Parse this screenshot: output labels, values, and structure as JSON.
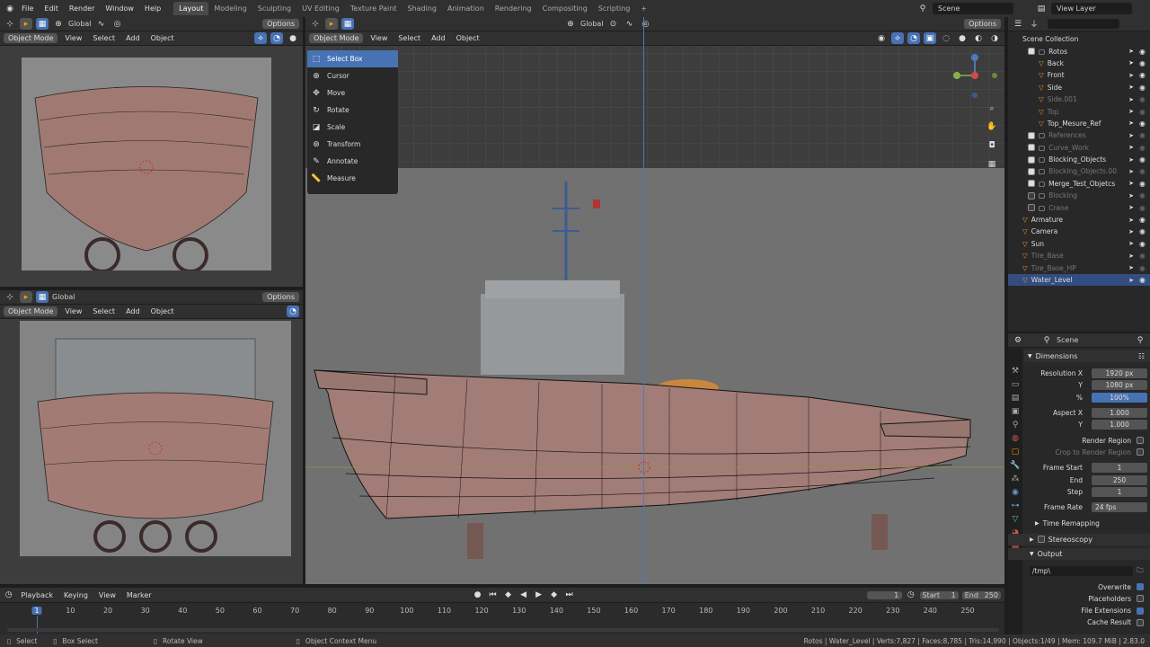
{
  "topbar": {
    "menus": [
      "File",
      "Edit",
      "Render",
      "Window",
      "Help"
    ],
    "tabs": [
      "Layout",
      "Modeling",
      "Sculpting",
      "UV Editing",
      "Texture Paint",
      "Shading",
      "Animation",
      "Rendering",
      "Compositing",
      "Scripting"
    ],
    "active_tab": "Layout",
    "scene_label": "Scene",
    "view_layer_label": "View Layer"
  },
  "viewport_header": {
    "mode": "Object Mode",
    "menus": [
      "View",
      "Select",
      "Add",
      "Object"
    ],
    "orientation": "Global",
    "options": "Options"
  },
  "toolbar": {
    "tools": [
      "Select Box",
      "Cursor",
      "Move",
      "Rotate",
      "Scale",
      "Transform",
      "Annotate",
      "Measure"
    ],
    "selected": "Select Box"
  },
  "outliner": {
    "root": "Scene Collection",
    "items": [
      {
        "label": "Rotos",
        "dim": false,
        "checked": true,
        "level": 1
      },
      {
        "label": "Back",
        "dim": false,
        "level": 2
      },
      {
        "label": "Front",
        "dim": false,
        "level": 2
      },
      {
        "label": "Side",
        "dim": false,
        "level": 2
      },
      {
        "label": "Side.001",
        "dim": true,
        "level": 2
      },
      {
        "label": "Top",
        "dim": true,
        "level": 2
      },
      {
        "label": "Top_Mesure_Ref",
        "dim": false,
        "level": 2
      },
      {
        "label": "References",
        "dim": true,
        "checked": true,
        "level": 1
      },
      {
        "label": "Curve_Work",
        "dim": true,
        "checked": true,
        "level": 1
      },
      {
        "label": "Blocking_Objects",
        "dim": false,
        "checked": true,
        "level": 1
      },
      {
        "label": "Blocking_Objects.00",
        "dim": true,
        "checked": true,
        "level": 1
      },
      {
        "label": "Merge_Test_Objetcs",
        "dim": false,
        "checked": true,
        "level": 1
      },
      {
        "label": "Blocking",
        "dim": true,
        "checked": false,
        "level": 1
      },
      {
        "label": "Crane",
        "dim": true,
        "checked": false,
        "level": 1
      },
      {
        "label": "Armature",
        "dim": false,
        "level": 0
      },
      {
        "label": "Camera",
        "dim": false,
        "level": 0
      },
      {
        "label": "Sun",
        "dim": false,
        "level": 0
      },
      {
        "label": "Tire_Base",
        "dim": true,
        "level": 0
      },
      {
        "label": "Tire_Base_HP",
        "dim": true,
        "level": 0
      },
      {
        "label": "Water_Level",
        "dim": false,
        "level": 0,
        "selected": true
      }
    ]
  },
  "properties": {
    "context": "Scene",
    "panel": "Dimensions",
    "resolution_x_label": "Resolution X",
    "resolution_x": "1920 px",
    "y_label": "Y",
    "resolution_y": "1080 px",
    "pct_label": "%",
    "percent": "100%",
    "aspect_x_label": "Aspect X",
    "aspect_x": "1.000",
    "aspect_y": "1.000",
    "render_region": "Render Region",
    "crop_region": "Crop to Render Region",
    "frame_start_label": "Frame Start",
    "frame_start": "1",
    "end_label": "End",
    "frame_end": "250",
    "step_label": "Step",
    "frame_step": "1",
    "frame_rate_label": "Frame Rate",
    "frame_rate": "24 fps",
    "time_remapping": "Time Remapping",
    "stereoscopy": "Stereoscopy",
    "output": "Output",
    "output_path": "/tmp\\",
    "overwrite": "Overwrite",
    "placeholders": "Placeholders",
    "file_extensions": "File Extensions",
    "cache_result": "Cache Result"
  },
  "timeline": {
    "menus": [
      "Playback",
      "Keying",
      "View",
      "Marker"
    ],
    "current_frame": "1",
    "start_label": "Start",
    "start": "1",
    "end_label": "End",
    "end": "250",
    "ticks": [
      "1",
      "10",
      "20",
      "30",
      "40",
      "50",
      "60",
      "70",
      "80",
      "90",
      "100",
      "110",
      "120",
      "130",
      "140",
      "150",
      "160",
      "170",
      "180",
      "190",
      "200",
      "210",
      "220",
      "230",
      "240",
      "250"
    ]
  },
  "statusbar": {
    "select": "Select",
    "box_select": "Box Select",
    "rotate_view": "Rotate View",
    "context_menu": "Object Context Menu",
    "stats": "Rotos | Water_Level | Verts:7,827 | Faces:8,785 | Tris:14,990 | Objects:1/49 | Mem: 109.7 MiB | 2.83.0"
  },
  "colors": {
    "accent": "#4772b3",
    "hull": "#a8807a"
  }
}
